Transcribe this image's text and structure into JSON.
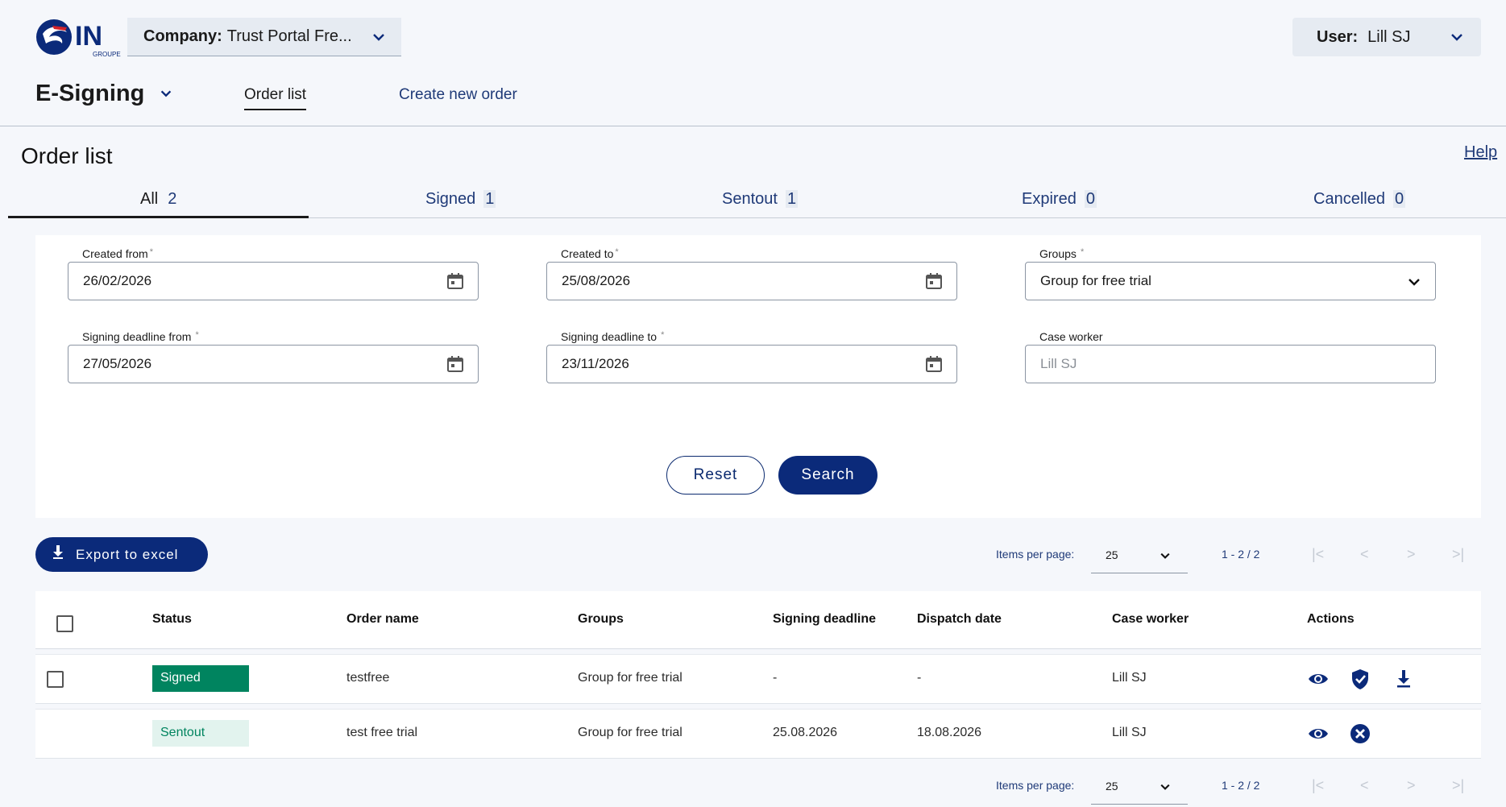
{
  "header": {
    "logo_text": "IN",
    "logo_subtext": "GROUPE",
    "company_label": "Company:",
    "company_value": "Trust Portal Fre...",
    "user_label": "User:",
    "user_value": "Lill SJ"
  },
  "app": {
    "title": "E-Signing",
    "nav_order_list": "Order list",
    "nav_create_order": "Create new order"
  },
  "page": {
    "title": "Order list",
    "help": "Help"
  },
  "tabs": [
    {
      "label": "All",
      "count": "2",
      "active": true
    },
    {
      "label": "Signed",
      "count": "1"
    },
    {
      "label": "Sentout",
      "count": "1"
    },
    {
      "label": "Expired",
      "count": "0"
    },
    {
      "label": "Cancelled",
      "count": "0"
    }
  ],
  "filters": {
    "created_from": {
      "label": "Created from",
      "value": "26/02/2026"
    },
    "created_to": {
      "label": "Created to",
      "value": "25/08/2026"
    },
    "groups": {
      "label": "Groups",
      "value": "Group for free trial"
    },
    "signing_from": {
      "label": "Signing deadline from",
      "value": "27/05/2026"
    },
    "signing_to": {
      "label": "Signing deadline to",
      "value": "23/11/2026"
    },
    "case_worker": {
      "label": "Case worker",
      "placeholder": "Lill SJ"
    },
    "reset_label": "Reset",
    "search_label": "Search"
  },
  "toolbar": {
    "export_label": "Export to excel"
  },
  "pagination": {
    "items_per_page_label": "Items per page:",
    "items_per_page_value": "25",
    "range": "1 - 2 / 2"
  },
  "table": {
    "columns": [
      "Status",
      "Order name",
      "Groups",
      "Signing deadline",
      "Dispatch date",
      "Case worker",
      "Actions"
    ],
    "rows": [
      {
        "status": "Signed",
        "order_name": "testfree",
        "group": "Group for free trial",
        "signing_deadline": "-",
        "dispatch_date": "-",
        "case_worker": "Lill SJ",
        "actions": [
          "eye-icon",
          "shield-check-icon",
          "download-icon"
        ]
      },
      {
        "status": "Sentout",
        "order_name": "test free trial",
        "group": "Group for free trial",
        "signing_deadline": "25.08.2026",
        "dispatch_date": "18.08.2026",
        "case_worker": "Lill SJ",
        "actions": [
          "eye-icon",
          "cancel-circle-icon"
        ]
      }
    ]
  },
  "colors": {
    "primary": "#0b2a7a",
    "link": "#1f3a78",
    "signed_badge": "#00845f",
    "sentout_badge_bg": "#e2f3ee",
    "logo_red": "#d2232a"
  }
}
